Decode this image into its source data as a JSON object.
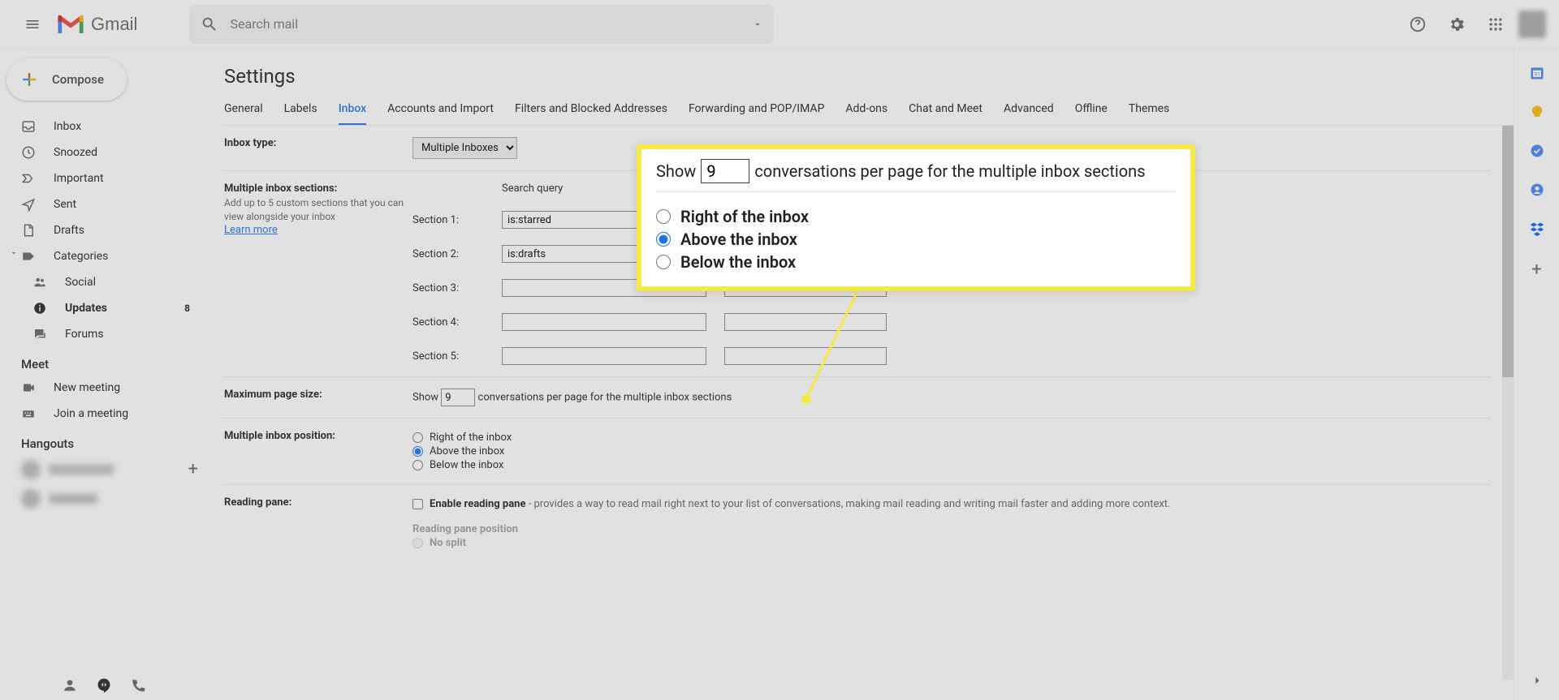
{
  "header": {
    "logo_text": "Gmail",
    "search_placeholder": "Search mail"
  },
  "sidebar": {
    "compose": "Compose",
    "items": [
      {
        "label": "Inbox"
      },
      {
        "label": "Snoozed"
      },
      {
        "label": "Important"
      },
      {
        "label": "Sent"
      },
      {
        "label": "Drafts"
      },
      {
        "label": "Categories"
      },
      {
        "label": "Social"
      },
      {
        "label": "Updates",
        "badge": "8"
      },
      {
        "label": "Forums"
      }
    ],
    "meet_head": "Meet",
    "meet_new": "New meeting",
    "meet_join": "Join a meeting",
    "hangouts_head": "Hangouts"
  },
  "page": {
    "title": "Settings",
    "tabs": [
      "General",
      "Labels",
      "Inbox",
      "Accounts and Import",
      "Filters and Blocked Addresses",
      "Forwarding and POP/IMAP",
      "Add-ons",
      "Chat and Meet",
      "Advanced",
      "Offline",
      "Themes"
    ],
    "active_tab": "Inbox"
  },
  "settings": {
    "inbox_type": {
      "label": "Inbox type:",
      "value": "Multiple Inboxes"
    },
    "multi_sections": {
      "label": "Multiple inbox sections:",
      "sub": "Add up to 5 custom sections that you can view alongside your inbox",
      "learn": "Learn more",
      "search_query": "Search query",
      "rows": [
        {
          "label": "Section 1:",
          "query": "is:starred",
          "name": ""
        },
        {
          "label": "Section 2:",
          "query": "is:drafts",
          "name": ""
        },
        {
          "label": "Section 3:",
          "query": "",
          "name": ""
        },
        {
          "label": "Section 4:",
          "query": "",
          "name": ""
        },
        {
          "label": "Section 5:",
          "query": "",
          "name": ""
        }
      ]
    },
    "max_page": {
      "label": "Maximum page size:",
      "show": "Show",
      "value": "9",
      "suffix": "conversations per page for the multiple inbox sections"
    },
    "position": {
      "label": "Multiple inbox position:",
      "options": [
        "Right of the inbox",
        "Above the inbox",
        "Below the inbox"
      ],
      "selected": "Above the inbox"
    },
    "reading": {
      "label": "Reading pane:",
      "enable": "Enable reading pane",
      "desc": " - provides a way to read mail right next to your list of conversations, making mail reading and writing mail faster and adding more context.",
      "pos_head": "Reading pane position",
      "no_split": "No split"
    }
  },
  "callout": {
    "show": "Show",
    "value": "9",
    "suffix": "conversations per page for the multiple inbox sections",
    "options": [
      "Right of the inbox",
      "Above the inbox",
      "Below the inbox"
    ],
    "selected": "Above the inbox"
  }
}
